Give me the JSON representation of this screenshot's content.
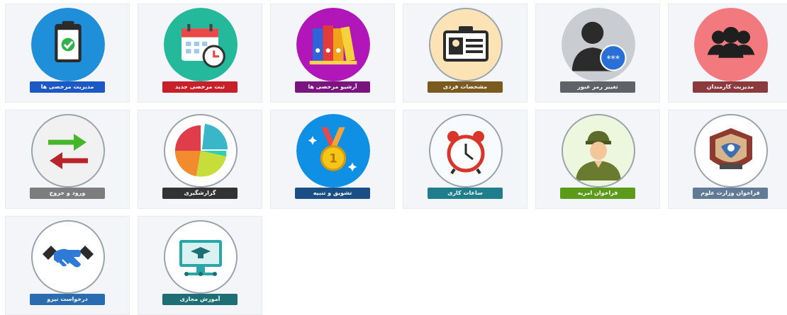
{
  "tiles": [
    {
      "label": "مدیریت کارمندان",
      "icon": "employees-group-icon",
      "circle_color": "#f27a7e",
      "label_color": "#8b3b3e"
    },
    {
      "label": "تغییر رمز عبور",
      "icon": "user-password-icon",
      "circle_color": "#c9ccd0",
      "label_color": "#5f6367"
    },
    {
      "label": "مشخصات فردی",
      "icon": "id-card-icon",
      "circle_color": "#fbe3b6",
      "label_color": "#7a5a1e"
    },
    {
      "label": "آرشیو مرخصی ها",
      "icon": "archive-binders-icon",
      "circle_color": "#b116b8",
      "label_color": "#7a1580"
    },
    {
      "label": "ثبت مرخصی جدید",
      "icon": "calendar-clock-icon",
      "circle_color": "#23b99a",
      "label_color": "#c8202a"
    },
    {
      "label": "مدیریت مرخصی ها",
      "icon": "clipboard-check-icon",
      "circle_color": "#1e8fd8",
      "label_color": "#1d59c4"
    },
    {
      "label": "فراخوان وزارت علوم",
      "icon": "ministry-emblem-icon",
      "circle_color": "#ffffff",
      "label_color": "#617a96"
    },
    {
      "label": "فراخوان امریه",
      "icon": "soldier-icon",
      "circle_color": "#edf7dd",
      "label_color": "#5c9a1a"
    },
    {
      "label": "ساعات کاری",
      "icon": "alarm-clock-icon",
      "circle_color": "#f7fbfd",
      "label_color": "#1f7e8c"
    },
    {
      "label": "تشویق و تنبیه",
      "icon": "medal-icon",
      "circle_color": "#1090e5",
      "label_color": "#1a4f86"
    },
    {
      "label": "گزارشگیری",
      "icon": "pie-chart-icon",
      "circle_color": "#ffffff",
      "label_color": "#333333"
    },
    {
      "label": "ورود و خروج",
      "icon": "enter-exit-arrows-icon",
      "circle_color": "#f1f1f1",
      "label_color": "#7d7d7d"
    },
    {
      "label": "درخواست نیرو",
      "icon": "handshake-icon",
      "circle_color": "#ffffff",
      "label_color": "#2b6cb0"
    },
    {
      "label": "آموزش مجازی",
      "icon": "e-learning-monitor-icon",
      "circle_color": "#ffffff",
      "label_color": "#1e6e76"
    }
  ]
}
